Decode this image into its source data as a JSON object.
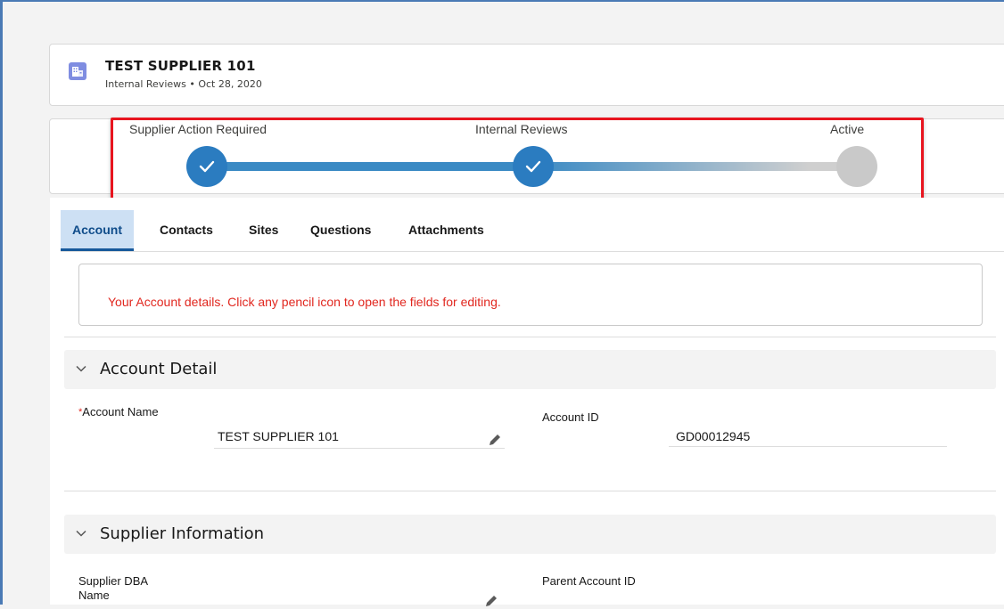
{
  "record": {
    "title": "TEST SUPPLIER 101",
    "subtitle": "Internal Reviews • Oct 28, 2020",
    "icon": "building-icon"
  },
  "path": {
    "stages": [
      {
        "label": "Supplier Action Required",
        "status": "complete"
      },
      {
        "label": "Internal Reviews",
        "status": "complete"
      },
      {
        "label": "Active",
        "status": "incomplete"
      }
    ],
    "highlight_color": "#e8151f"
  },
  "tabs": [
    {
      "label": "Account",
      "active": true
    },
    {
      "label": "Contacts",
      "active": false
    },
    {
      "label": "Sites",
      "active": false
    },
    {
      "label": "Questions",
      "active": false
    },
    {
      "label": "Attachments",
      "active": false
    }
  ],
  "info_message": "Your Account details. Click any pencil icon to open the fields for editing.",
  "sections": {
    "account_detail": {
      "title": "Account Detail",
      "account_name_label": "Account Name",
      "account_name_required_mark": "*",
      "account_name_value": "TEST SUPPLIER 101",
      "account_id_label": "Account ID",
      "account_id_value": "GD00012945"
    },
    "supplier_information": {
      "title": "Supplier Information",
      "dba_label_line1": "Supplier DBA",
      "dba_label_line2": "Name",
      "parent_id_label": "Parent Account ID"
    }
  },
  "colors": {
    "accent": "#2b7cc0",
    "tab_active_bg": "#cde0f4",
    "error_text": "#e1271f"
  }
}
